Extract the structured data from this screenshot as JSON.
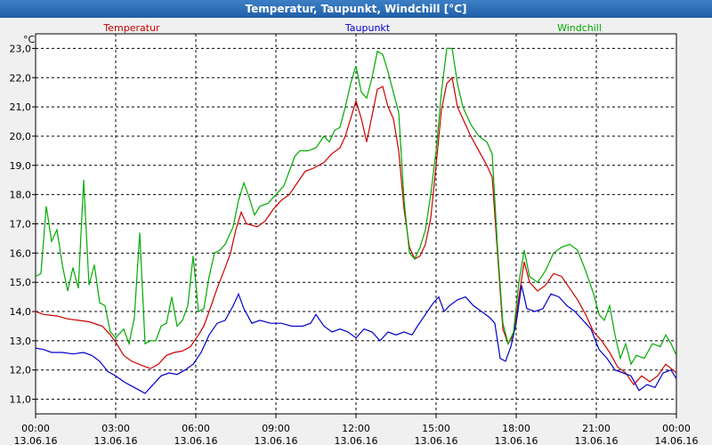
{
  "window": {
    "title": "Temperatur, Taupunkt, Windchill [°C]"
  },
  "chart_data": {
    "type": "line",
    "ylabel": "°C",
    "ylim": [
      10.5,
      23.5
    ],
    "yticks": [
      "11,0",
      "12,0",
      "13,0",
      "14,0",
      "15,0",
      "16,0",
      "17,0",
      "18,0",
      "19,0",
      "20,0",
      "21,0",
      "22,0",
      "23,0"
    ],
    "ytick_values": [
      11,
      12,
      13,
      14,
      15,
      16,
      17,
      18,
      19,
      20,
      21,
      22,
      23
    ],
    "xlim": [
      0,
      24
    ],
    "xticks": [
      {
        "time": "00:00",
        "date": "13.06.16",
        "h": 0
      },
      {
        "time": "03:00",
        "date": "13.06.16",
        "h": 3
      },
      {
        "time": "06:00",
        "date": "13.06.16",
        "h": 6
      },
      {
        "time": "09:00",
        "date": "13.06.16",
        "h": 9
      },
      {
        "time": "12:00",
        "date": "13.06.16",
        "h": 12
      },
      {
        "time": "15:00",
        "date": "13.06.16",
        "h": 15
      },
      {
        "time": "18:00",
        "date": "13.06.16",
        "h": 18
      },
      {
        "time": "21:00",
        "date": "13.06.16",
        "h": 21
      },
      {
        "time": "00:00",
        "date": "14.06.16",
        "h": 24
      }
    ],
    "grid": true,
    "legend": "top",
    "series": [
      {
        "name": "Temperatur",
        "color": "#cc0000",
        "points": [
          [
            0,
            14.0
          ],
          [
            0.3,
            13.9
          ],
          [
            0.8,
            13.85
          ],
          [
            1.2,
            13.75
          ],
          [
            1.6,
            13.7
          ],
          [
            2.0,
            13.65
          ],
          [
            2.5,
            13.5
          ],
          [
            2.8,
            13.2
          ],
          [
            3.0,
            12.95
          ],
          [
            3.3,
            12.5
          ],
          [
            3.6,
            12.3
          ],
          [
            4.0,
            12.15
          ],
          [
            4.3,
            12.05
          ],
          [
            4.6,
            12.2
          ],
          [
            4.9,
            12.5
          ],
          [
            5.2,
            12.6
          ],
          [
            5.5,
            12.65
          ],
          [
            5.8,
            12.8
          ],
          [
            6.1,
            13.2
          ],
          [
            6.3,
            13.5
          ],
          [
            6.5,
            14.0
          ],
          [
            6.8,
            14.8
          ],
          [
            7.1,
            15.5
          ],
          [
            7.3,
            16.0
          ],
          [
            7.5,
            16.8
          ],
          [
            7.7,
            17.4
          ],
          [
            7.9,
            17.0
          ],
          [
            8.3,
            16.9
          ],
          [
            8.6,
            17.1
          ],
          [
            8.9,
            17.5
          ],
          [
            9.2,
            17.8
          ],
          [
            9.5,
            18.0
          ],
          [
            9.8,
            18.4
          ],
          [
            10.1,
            18.8
          ],
          [
            10.4,
            18.9
          ],
          [
            10.8,
            19.1
          ],
          [
            11.1,
            19.4
          ],
          [
            11.4,
            19.6
          ],
          [
            11.6,
            20.0
          ],
          [
            11.8,
            20.6
          ],
          [
            12.0,
            21.2
          ],
          [
            12.2,
            20.6
          ],
          [
            12.4,
            19.8
          ],
          [
            12.6,
            20.7
          ],
          [
            12.8,
            21.6
          ],
          [
            13.0,
            21.7
          ],
          [
            13.2,
            21.0
          ],
          [
            13.4,
            20.6
          ],
          [
            13.6,
            19.5
          ],
          [
            13.8,
            17.5
          ],
          [
            14.0,
            16.2
          ],
          [
            14.2,
            15.8
          ],
          [
            14.4,
            15.9
          ],
          [
            14.6,
            16.3
          ],
          [
            14.8,
            17.2
          ],
          [
            15.0,
            19.0
          ],
          [
            15.2,
            20.9
          ],
          [
            15.4,
            21.8
          ],
          [
            15.6,
            22.0
          ],
          [
            15.8,
            21.0
          ],
          [
            16.0,
            20.6
          ],
          [
            16.3,
            20.0
          ],
          [
            16.6,
            19.5
          ],
          [
            16.9,
            19.0
          ],
          [
            17.1,
            18.6
          ],
          [
            17.3,
            16.0
          ],
          [
            17.5,
            13.4
          ],
          [
            17.7,
            12.9
          ],
          [
            17.9,
            13.2
          ],
          [
            18.1,
            14.5
          ],
          [
            18.3,
            15.7
          ],
          [
            18.5,
            15.0
          ],
          [
            18.8,
            14.7
          ],
          [
            19.1,
            14.9
          ],
          [
            19.4,
            15.3
          ],
          [
            19.7,
            15.2
          ],
          [
            20.0,
            14.8
          ],
          [
            20.3,
            14.4
          ],
          [
            20.6,
            13.9
          ],
          [
            20.9,
            13.3
          ],
          [
            21.2,
            13.0
          ],
          [
            21.5,
            12.6
          ],
          [
            21.8,
            12.1
          ],
          [
            22.1,
            11.9
          ],
          [
            22.4,
            11.5
          ],
          [
            22.7,
            11.8
          ],
          [
            23.0,
            11.6
          ],
          [
            23.3,
            11.8
          ],
          [
            23.6,
            12.2
          ],
          [
            24.0,
            11.9
          ]
        ]
      },
      {
        "name": "Taupunkt",
        "color": "#0000cc",
        "points": [
          [
            0,
            12.75
          ],
          [
            0.3,
            12.7
          ],
          [
            0.6,
            12.6
          ],
          [
            1.0,
            12.6
          ],
          [
            1.4,
            12.55
          ],
          [
            1.8,
            12.6
          ],
          [
            2.1,
            12.5
          ],
          [
            2.4,
            12.3
          ],
          [
            2.7,
            11.95
          ],
          [
            3.0,
            11.8
          ],
          [
            3.3,
            11.6
          ],
          [
            3.6,
            11.45
          ],
          [
            3.9,
            11.3
          ],
          [
            4.1,
            11.2
          ],
          [
            4.4,
            11.5
          ],
          [
            4.7,
            11.8
          ],
          [
            5.0,
            11.9
          ],
          [
            5.3,
            11.85
          ],
          [
            5.6,
            12.0
          ],
          [
            5.9,
            12.2
          ],
          [
            6.2,
            12.6
          ],
          [
            6.5,
            13.2
          ],
          [
            6.8,
            13.6
          ],
          [
            7.1,
            13.7
          ],
          [
            7.4,
            14.2
          ],
          [
            7.6,
            14.6
          ],
          [
            7.8,
            14.1
          ],
          [
            8.1,
            13.6
          ],
          [
            8.4,
            13.7
          ],
          [
            8.8,
            13.6
          ],
          [
            9.2,
            13.6
          ],
          [
            9.6,
            13.5
          ],
          [
            10.0,
            13.5
          ],
          [
            10.3,
            13.6
          ],
          [
            10.5,
            13.9
          ],
          [
            10.8,
            13.5
          ],
          [
            11.1,
            13.3
          ],
          [
            11.4,
            13.4
          ],
          [
            11.7,
            13.3
          ],
          [
            12.0,
            13.1
          ],
          [
            12.3,
            13.4
          ],
          [
            12.6,
            13.3
          ],
          [
            12.9,
            13.0
          ],
          [
            13.2,
            13.3
          ],
          [
            13.5,
            13.2
          ],
          [
            13.8,
            13.3
          ],
          [
            14.1,
            13.2
          ],
          [
            14.3,
            13.5
          ],
          [
            14.6,
            13.9
          ],
          [
            14.9,
            14.3
          ],
          [
            15.1,
            14.5
          ],
          [
            15.3,
            14.0
          ],
          [
            15.5,
            14.2
          ],
          [
            15.8,
            14.4
          ],
          [
            16.1,
            14.5
          ],
          [
            16.4,
            14.2
          ],
          [
            16.7,
            14.0
          ],
          [
            17.0,
            13.8
          ],
          [
            17.2,
            13.6
          ],
          [
            17.4,
            12.4
          ],
          [
            17.6,
            12.3
          ],
          [
            17.8,
            12.8
          ],
          [
            18.0,
            13.6
          ],
          [
            18.2,
            14.9
          ],
          [
            18.4,
            14.1
          ],
          [
            18.7,
            14.0
          ],
          [
            19.0,
            14.1
          ],
          [
            19.3,
            14.6
          ],
          [
            19.6,
            14.5
          ],
          [
            19.9,
            14.2
          ],
          [
            20.2,
            14.0
          ],
          [
            20.5,
            13.7
          ],
          [
            20.8,
            13.4
          ],
          [
            21.1,
            12.7
          ],
          [
            21.4,
            12.4
          ],
          [
            21.7,
            12.0
          ],
          [
            22.0,
            11.9
          ],
          [
            22.3,
            11.8
          ],
          [
            22.6,
            11.3
          ],
          [
            22.9,
            11.5
          ],
          [
            23.2,
            11.4
          ],
          [
            23.5,
            11.9
          ],
          [
            23.8,
            12.0
          ],
          [
            24.0,
            11.7
          ]
        ]
      },
      {
        "name": "Windchill",
        "color": "#00aa00",
        "points": [
          [
            0,
            15.2
          ],
          [
            0.2,
            15.3
          ],
          [
            0.4,
            17.6
          ],
          [
            0.6,
            16.4
          ],
          [
            0.8,
            16.8
          ],
          [
            1.0,
            15.6
          ],
          [
            1.2,
            14.7
          ],
          [
            1.4,
            15.5
          ],
          [
            1.6,
            14.8
          ],
          [
            1.8,
            18.5
          ],
          [
            2.0,
            14.9
          ],
          [
            2.2,
            15.6
          ],
          [
            2.4,
            14.3
          ],
          [
            2.6,
            14.2
          ],
          [
            2.8,
            13.3
          ],
          [
            3.0,
            13.1
          ],
          [
            3.3,
            13.4
          ],
          [
            3.5,
            12.9
          ],
          [
            3.7,
            13.8
          ],
          [
            3.9,
            16.7
          ],
          [
            4.1,
            12.9
          ],
          [
            4.3,
            13.0
          ],
          [
            4.5,
            13.0
          ],
          [
            4.7,
            13.5
          ],
          [
            4.9,
            13.6
          ],
          [
            5.1,
            14.5
          ],
          [
            5.3,
            13.5
          ],
          [
            5.5,
            13.7
          ],
          [
            5.7,
            14.2
          ],
          [
            5.9,
            15.9
          ],
          [
            6.1,
            14.0
          ],
          [
            6.3,
            14.1
          ],
          [
            6.5,
            15.2
          ],
          [
            6.7,
            16.0
          ],
          [
            6.9,
            16.1
          ],
          [
            7.1,
            16.3
          ],
          [
            7.4,
            16.9
          ],
          [
            7.6,
            17.8
          ],
          [
            7.8,
            18.4
          ],
          [
            8.0,
            17.9
          ],
          [
            8.2,
            17.3
          ],
          [
            8.4,
            17.6
          ],
          [
            8.7,
            17.7
          ],
          [
            9.0,
            18.0
          ],
          [
            9.3,
            18.3
          ],
          [
            9.5,
            18.8
          ],
          [
            9.7,
            19.3
          ],
          [
            9.9,
            19.5
          ],
          [
            10.2,
            19.5
          ],
          [
            10.5,
            19.6
          ],
          [
            10.8,
            20.0
          ],
          [
            11.0,
            19.8
          ],
          [
            11.2,
            20.2
          ],
          [
            11.4,
            20.3
          ],
          [
            11.6,
            21.0
          ],
          [
            11.8,
            21.8
          ],
          [
            12.0,
            22.4
          ],
          [
            12.2,
            21.5
          ],
          [
            12.4,
            21.3
          ],
          [
            12.6,
            22.0
          ],
          [
            12.8,
            22.9
          ],
          [
            13.0,
            22.8
          ],
          [
            13.2,
            22.2
          ],
          [
            13.4,
            21.5
          ],
          [
            13.6,
            20.8
          ],
          [
            13.8,
            17.8
          ],
          [
            14.0,
            16.0
          ],
          [
            14.2,
            15.8
          ],
          [
            14.4,
            16.2
          ],
          [
            14.6,
            16.8
          ],
          [
            14.8,
            18.0
          ],
          [
            15.0,
            19.5
          ],
          [
            15.2,
            21.5
          ],
          [
            15.4,
            23.0
          ],
          [
            15.6,
            23.0
          ],
          [
            15.8,
            21.8
          ],
          [
            16.0,
            21.0
          ],
          [
            16.3,
            20.4
          ],
          [
            16.6,
            20.0
          ],
          [
            16.9,
            19.8
          ],
          [
            17.1,
            19.4
          ],
          [
            17.3,
            16.2
          ],
          [
            17.5,
            13.6
          ],
          [
            17.7,
            12.9
          ],
          [
            17.9,
            13.3
          ],
          [
            18.1,
            15.0
          ],
          [
            18.3,
            16.1
          ],
          [
            18.5,
            15.2
          ],
          [
            18.8,
            15.0
          ],
          [
            19.1,
            15.4
          ],
          [
            19.4,
            16.0
          ],
          [
            19.7,
            16.2
          ],
          [
            20.0,
            16.3
          ],
          [
            20.3,
            16.1
          ],
          [
            20.6,
            15.4
          ],
          [
            20.9,
            14.6
          ],
          [
            21.1,
            13.9
          ],
          [
            21.3,
            13.7
          ],
          [
            21.5,
            14.2
          ],
          [
            21.7,
            13.2
          ],
          [
            21.9,
            12.4
          ],
          [
            22.1,
            12.9
          ],
          [
            22.3,
            12.2
          ],
          [
            22.5,
            12.5
          ],
          [
            22.8,
            12.4
          ],
          [
            23.1,
            12.9
          ],
          [
            23.4,
            12.8
          ],
          [
            23.6,
            13.2
          ],
          [
            23.8,
            12.9
          ],
          [
            24.0,
            12.5
          ]
        ]
      }
    ]
  }
}
